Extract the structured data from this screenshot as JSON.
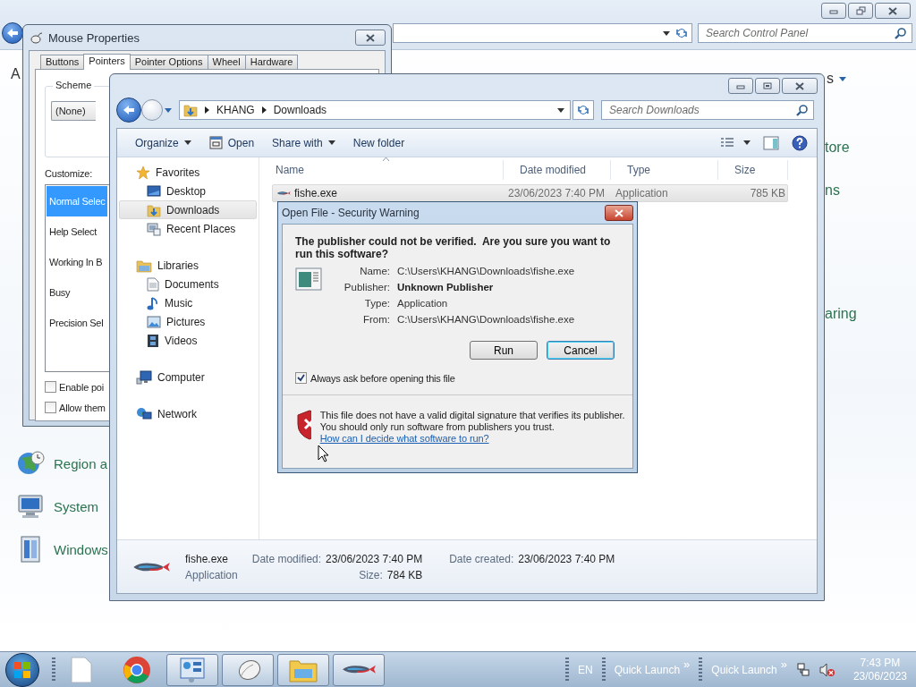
{
  "control_panel": {
    "search_placeholder": "Search Control Panel",
    "heading_fragment": "A",
    "view_fragment": "s",
    "right_items": [
      "tore",
      "ns",
      "aring"
    ],
    "left_items": [
      {
        "label": "Region a",
        "kind": "globe"
      },
      {
        "label": "System",
        "kind": "computer"
      },
      {
        "label": "Windows",
        "kind": "update"
      }
    ]
  },
  "mouse_properties": {
    "title": "Mouse Properties",
    "tabs": [
      {
        "label": "Buttons",
        "selected": false
      },
      {
        "label": "Pointers",
        "selected": true
      },
      {
        "label": "Pointer Options",
        "selected": false
      },
      {
        "label": "Wheel",
        "selected": false
      },
      {
        "label": "Hardware",
        "selected": false
      }
    ],
    "scheme_label": "Scheme",
    "scheme_value": "(None)",
    "customize_label": "Customize:",
    "pointers": [
      {
        "label": "Normal Selec",
        "selected": true
      },
      {
        "label": "Help Select",
        "selected": false
      },
      {
        "label": "Working In B",
        "selected": false
      },
      {
        "label": "Busy",
        "selected": false
      },
      {
        "label": "Precision Sel",
        "selected": false
      }
    ],
    "options": [
      {
        "label": "Enable poi",
        "checked": false
      },
      {
        "label": "Allow them",
        "checked": false
      }
    ]
  },
  "explorer": {
    "breadcrumb": [
      "KHANG",
      "Downloads"
    ],
    "search_placeholder": "Search Downloads",
    "toolbar": [
      {
        "label": "Organize",
        "kind": "menu"
      },
      {
        "label": "Open",
        "kind": "icon"
      },
      {
        "label": "Share with",
        "kind": "menu"
      },
      {
        "label": "New folder",
        "kind": "plain"
      }
    ],
    "navigation": [
      {
        "label": "Favorites",
        "kind": "star",
        "selected": false,
        "children": [
          {
            "label": "Desktop",
            "kind": "desktop",
            "selected": false
          },
          {
            "label": "Downloads",
            "kind": "downloads",
            "selected": true
          },
          {
            "label": "Recent Places",
            "kind": "recent",
            "selected": false
          }
        ]
      },
      {
        "label": "Libraries",
        "kind": "library",
        "selected": false,
        "children": [
          {
            "label": "Documents",
            "kind": "document",
            "selected": false
          },
          {
            "label": "Music",
            "kind": "music",
            "selected": false
          },
          {
            "label": "Pictures",
            "kind": "pictures",
            "selected": false
          },
          {
            "label": "Videos",
            "kind": "video",
            "selected": false
          }
        ]
      },
      {
        "label": "Computer",
        "kind": "computer",
        "selected": false
      },
      {
        "label": "Network",
        "kind": "network",
        "selected": false
      }
    ],
    "columns": [
      "Name",
      "Date modified",
      "Type",
      "Size"
    ],
    "files": [
      {
        "name": "fishe.exe",
        "date_modified": "23/06/2023 7:40 PM",
        "type": "Application",
        "size": "785 KB",
        "selected": true
      }
    ],
    "details": {
      "name": "fishe.exe",
      "type": "Application",
      "fields": [
        {
          "label": "Date modified:",
          "value": "23/06/2023 7:40 PM"
        },
        {
          "label": "Size:",
          "value": "784 KB"
        },
        {
          "label": "Date created:",
          "value": "23/06/2023 7:40 PM"
        }
      ]
    }
  },
  "dialog": {
    "title": "Open File - Security Warning",
    "heading": "The publisher could not be verified.  Are you sure you want to run this software?",
    "fields": [
      {
        "label": "Name:",
        "value": "C:\\Users\\KHANG\\Downloads\\fishe.exe",
        "emphasis": false
      },
      {
        "label": "Publisher:",
        "value": "Unknown Publisher",
        "emphasis": true
      },
      {
        "label": "Type:",
        "value": "Application",
        "emphasis": false
      },
      {
        "label": "From:",
        "value": "C:\\Users\\KHANG\\Downloads\\fishe.exe",
        "emphasis": false
      }
    ],
    "buttons": [
      {
        "label": "Run",
        "focused": false
      },
      {
        "label": "Cancel",
        "focused": true
      }
    ],
    "always_ask": {
      "label": "Always ask before opening this file",
      "checked": true
    },
    "warning": "This file does not have a valid digital signature that verifies its publisher.  You should only run software from publishers you trust.",
    "link": "How can I decide what software to run?"
  },
  "taskbar": {
    "buttons": [
      {
        "kind": "document",
        "active": false
      },
      {
        "kind": "browser",
        "active": false
      },
      {
        "kind": "control-panel",
        "active": true
      },
      {
        "kind": "mouse",
        "active": true
      },
      {
        "kind": "explorer",
        "active": true
      },
      {
        "kind": "fish",
        "active": true
      }
    ],
    "language": "EN",
    "toolbars": [
      {
        "label": "Quick Launch",
        "chevron": "»"
      },
      {
        "label": "Quick Launch",
        "chevron": "»"
      }
    ],
    "time": "7:43 PM",
    "date": "23/06/2023"
  }
}
